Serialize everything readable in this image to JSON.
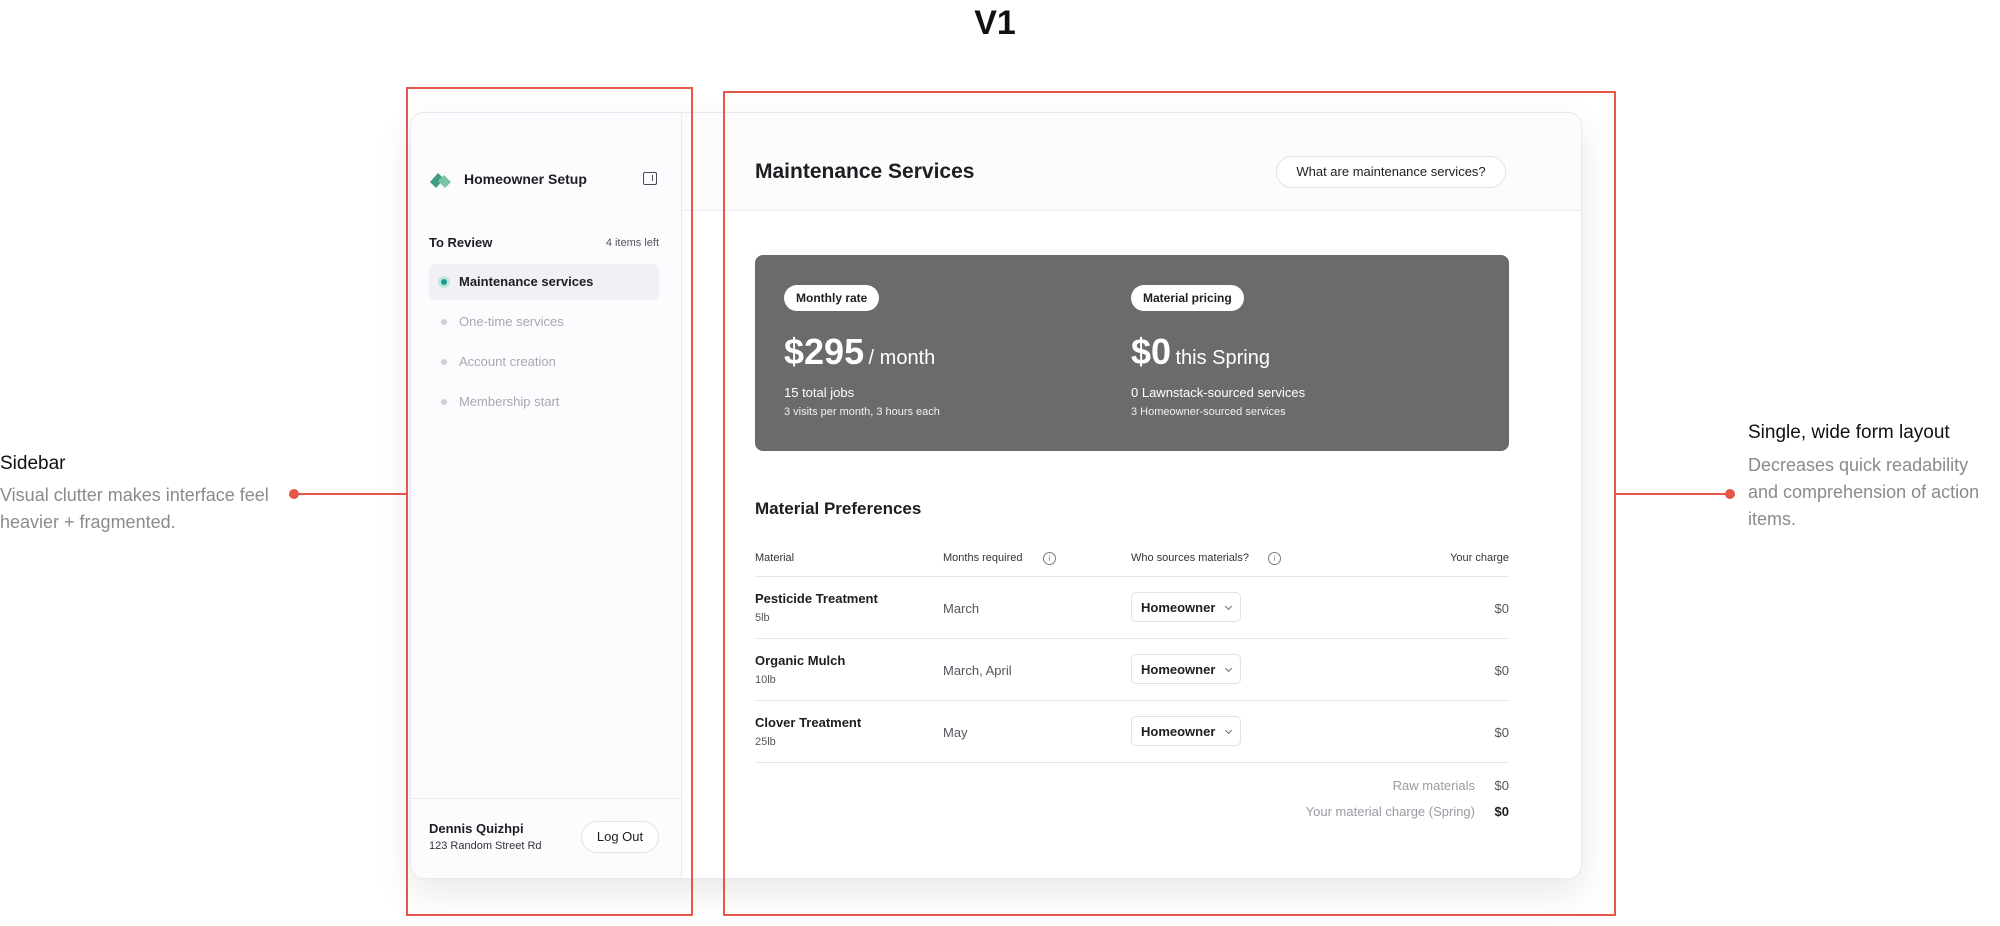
{
  "heading": "V1",
  "annotations": {
    "sidebar": {
      "title": "Sidebar",
      "body": "Visual clutter makes interface feel heavier + fragmented."
    },
    "layout": {
      "title": "Single, wide form layout",
      "body": "Decreases quick readability and comprehension of action items."
    },
    "color": "#e5574b"
  },
  "sidebar": {
    "brand": "Homeowner Setup",
    "logo_icon": "leaf-logo-icon",
    "collapse_icon": "sidebar-collapse-icon",
    "review_title": "To Review",
    "review_count": "4 items left",
    "items": [
      {
        "label": "Maintenance services",
        "active": true
      },
      {
        "label": "One-time services",
        "active": false
      },
      {
        "label": "Account creation",
        "active": false
      },
      {
        "label": "Membership start",
        "active": false
      }
    ],
    "user": {
      "name": "Dennis Quizhpi",
      "address": "123 Random Street Rd"
    },
    "logout_label": "Log Out"
  },
  "main": {
    "title": "Maintenance Services",
    "help_label": "What are maintenance services?",
    "summary": {
      "monthly": {
        "pill": "Monthly rate",
        "amount": "$295",
        "unit": "/ month",
        "line1": "15 total jobs",
        "line2": "3 visits per month, 3 hours each"
      },
      "material": {
        "pill": "Material pricing",
        "amount": "$0",
        "unit": "this Spring",
        "line1": "0 Lawnstack-sourced services",
        "line2": "3 Homeowner-sourced services"
      }
    },
    "section_title": "Material Preferences",
    "table": {
      "headers": [
        "Material",
        "Months required",
        "Who sources materials?",
        "Your charge"
      ],
      "rows": [
        {
          "name": "Pesticide Treatment",
          "weight": "5lb",
          "months": "March",
          "source": "Homeowner",
          "charge": "$0"
        },
        {
          "name": "Organic Mulch",
          "weight": "10lb",
          "months": "March, April",
          "source": "Homeowner",
          "charge": "$0"
        },
        {
          "name": "Clover Treatment",
          "weight": "25lb",
          "months": "May",
          "source": "Homeowner",
          "charge": "$0"
        }
      ]
    },
    "totals": [
      {
        "label": "Raw materials",
        "value": "$0"
      },
      {
        "label": "Your material charge (Spring)",
        "value": "$0"
      }
    ]
  },
  "colors": {
    "accent": "#1e9b8f",
    "summary_bg": "#6b6a6d"
  }
}
